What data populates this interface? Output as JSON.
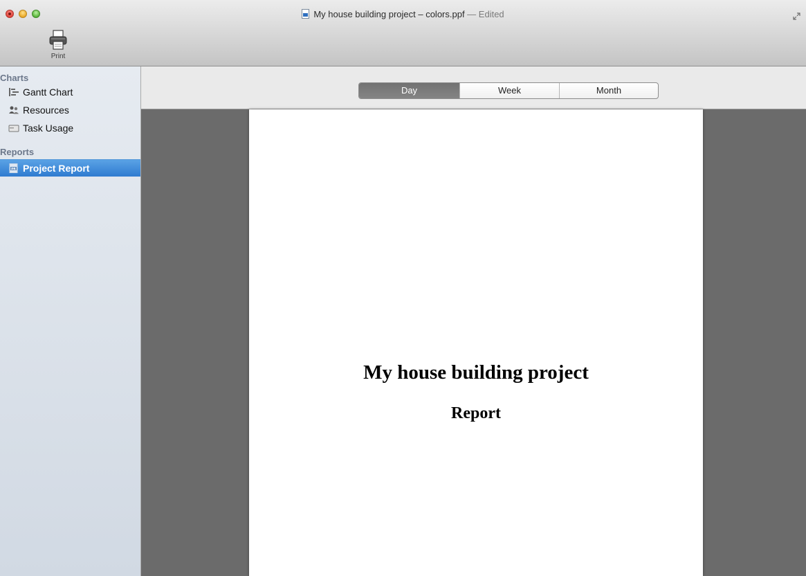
{
  "window": {
    "title": "My house building project – colors.ppf",
    "title_separator": " — ",
    "title_status": "Edited"
  },
  "toolbar": {
    "print_label": "Print"
  },
  "sidebar": {
    "charts_heading": "Charts",
    "chart_items": [
      {
        "label": "Gantt Chart",
        "icon": "gantt-icon"
      },
      {
        "label": "Resources",
        "icon": "resources-icon"
      },
      {
        "label": "Task Usage",
        "icon": "task-usage-icon"
      }
    ],
    "reports_heading": "Reports",
    "report_items": [
      {
        "label": "Project Report",
        "icon": "project-report-icon",
        "selected": true
      }
    ]
  },
  "view_selector": {
    "options": [
      "Day",
      "Week",
      "Month"
    ],
    "selected": "Day"
  },
  "report": {
    "title": "My house building project",
    "subtitle": "Report"
  },
  "colors": {
    "selection": "#2f7bd0",
    "canvas_background": "#6b6b6b",
    "segment_active": "#7a7a7a"
  }
}
